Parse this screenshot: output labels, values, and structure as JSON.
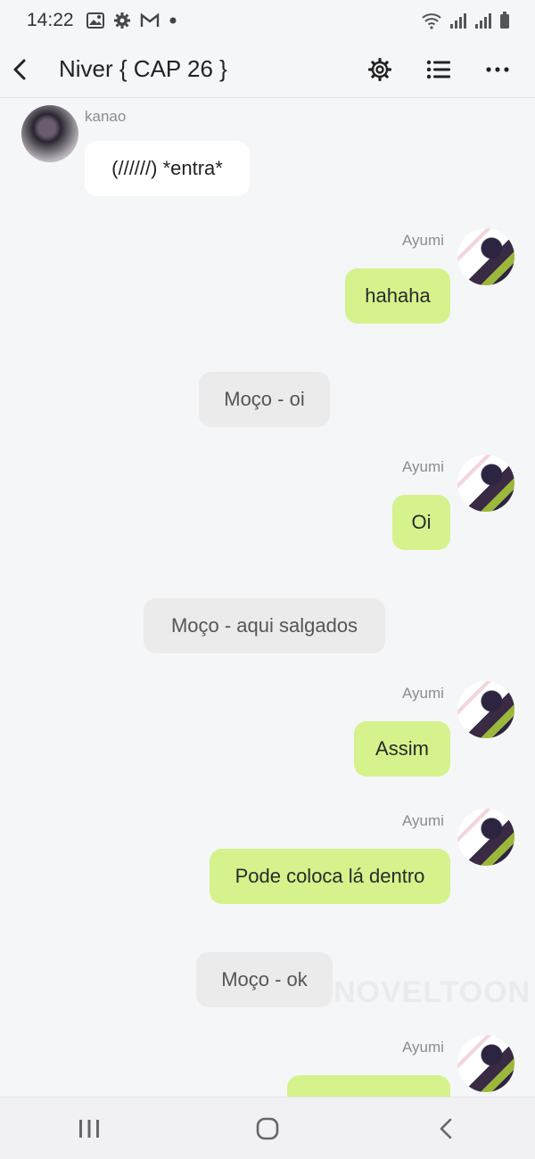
{
  "status_bar": {
    "time": "14:22",
    "left_icons": [
      "image-icon",
      "gear-icon",
      "gmail-icon",
      "dot-icon"
    ],
    "right_icons": [
      "wifi-icon",
      "signal-icon",
      "signal-icon",
      "battery-icon"
    ]
  },
  "header": {
    "title": "Niver { CAP 26 }",
    "icons": [
      "back-arrow-icon",
      "settings-icon",
      "list-icon",
      "more-icon"
    ]
  },
  "messages": [
    {
      "type": "incoming",
      "sender": "kanao",
      "text": "(//////) *entra*"
    },
    {
      "type": "outgoing",
      "sender": "Ayumi",
      "text": "hahaha"
    },
    {
      "type": "system",
      "text": "Moço - oi"
    },
    {
      "type": "outgoing",
      "sender": "Ayumi",
      "text": "Oi"
    },
    {
      "type": "system",
      "text": "Moço - aqui salgados"
    },
    {
      "type": "outgoing",
      "sender": "Ayumi",
      "text": "Assim"
    },
    {
      "type": "outgoing",
      "sender": "Ayumi",
      "text": "Pode coloca lá dentro"
    },
    {
      "type": "system",
      "text": "Moço - ok"
    },
    {
      "type": "outgoing",
      "sender": "Ayumi",
      "text": ""
    }
  ],
  "watermark": "NOVELTOON",
  "nav_bar": {
    "icons": [
      "recent-apps-icon",
      "home-icon",
      "back-icon"
    ]
  },
  "colors": {
    "background": "#f5f6f8",
    "outgoing_bubble": "#d5f28c",
    "incoming_bubble": "#ffffff",
    "system_bubble": "#ebebeb"
  }
}
